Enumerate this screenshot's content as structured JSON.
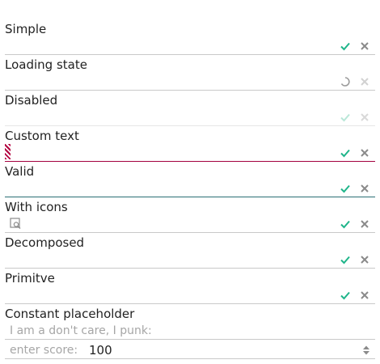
{
  "fields": [
    {
      "label": "Simple",
      "state": "normal"
    },
    {
      "label": "Loading state",
      "state": "loading"
    },
    {
      "label": "Disabled",
      "state": "disabled"
    },
    {
      "label": "Custom text",
      "state": "invalid"
    },
    {
      "label": "Valid",
      "state": "valid"
    },
    {
      "label": "With icons",
      "state": "icon"
    },
    {
      "label": "Decomposed",
      "state": "normal"
    },
    {
      "label": "Primitve",
      "state": "normal"
    }
  ],
  "constant_placeholder": {
    "label": "Constant placeholder",
    "placeholder": "I am a don't care, I punk:",
    "score_placeholder": "enter score:",
    "score_value": "100"
  },
  "colors": {
    "accent_green": "#1fb58a",
    "clear_gray": "#8a8a8a",
    "invalid": "#a3003f",
    "valid": "#2a6f74"
  },
  "icons": {
    "confirm": "check-icon",
    "clear": "close-icon",
    "loading": "spinner-icon",
    "prefix": "search-document-icon",
    "stepper": "stepper-icon"
  }
}
